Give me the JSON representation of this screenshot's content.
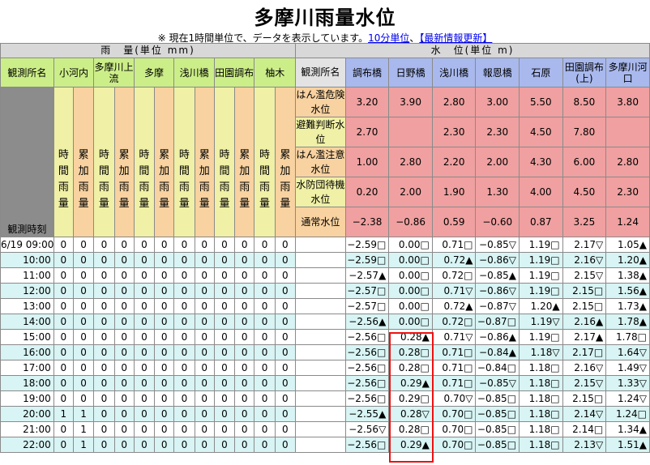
{
  "page": {
    "title": "多摩川雨量水位",
    "notice_prefix": "※ 現在1時間単位で、データを表示しています。",
    "link_10min": "10分単位",
    "link_refresh": "【最新情報更新】"
  },
  "rain_section": {
    "header": "雨　量(単位 mm)",
    "station_label": "観測所名",
    "stations": [
      "小河内",
      "多摩川上流",
      "多摩",
      "浅川橋",
      "田園調布",
      "柚木"
    ],
    "col_hourly": "時間雨量",
    "col_cumulative": "累加雨量",
    "time_label": "観測時刻"
  },
  "level_section": {
    "header": "水　位(単位 m)",
    "station_label": "観測所名",
    "stations": [
      "調布橋",
      "日野橋",
      "浅川橋",
      "報恩橋",
      "石原",
      "田園調布(上)",
      "多摩川河口"
    ],
    "levels": [
      {
        "name": "はん濫危険水位",
        "values": [
          "3.20",
          "3.90",
          "2.80",
          "3.00",
          "5.50",
          "8.50",
          "3.80"
        ]
      },
      {
        "name": "避難判断水位",
        "values": [
          "2.70",
          "",
          "2.30",
          "2.30",
          "4.50",
          "7.80",
          ""
        ]
      },
      {
        "name": "はん濫注意水位",
        "values": [
          "1.00",
          "2.80",
          "2.20",
          "2.00",
          "4.30",
          "6.00",
          "2.80"
        ]
      },
      {
        "name": "水防団待機水位",
        "values": [
          "0.20",
          "2.00",
          "1.90",
          "1.30",
          "4.00",
          "4.50",
          "2.30"
        ]
      },
      {
        "name": "通常水位",
        "values": [
          "−2.38",
          "−0.86",
          "0.59",
          "−0.60",
          "0.87",
          "3.25",
          "1.24"
        ]
      }
    ]
  },
  "data_rows": [
    {
      "time": "6/19 09:00",
      "rain": [
        "0",
        "0",
        "0",
        "0",
        "0",
        "0",
        "0",
        "0",
        "0",
        "0",
        "0",
        "0"
      ],
      "water": [
        "−2.59□",
        "0.00□",
        "0.71□",
        "−0.85▽",
        "1.19□",
        "2.17▽",
        "1.05▲"
      ]
    },
    {
      "time": "10:00",
      "rain": [
        "0",
        "0",
        "0",
        "0",
        "0",
        "0",
        "0",
        "0",
        "0",
        "0",
        "0",
        "0"
      ],
      "water": [
        "−2.59□",
        "0.00□",
        "0.72▲",
        "−0.86▽",
        "1.19□",
        "2.16▽",
        "1.20▲"
      ]
    },
    {
      "time": "11:00",
      "rain": [
        "0",
        "0",
        "0",
        "0",
        "0",
        "0",
        "0",
        "0",
        "0",
        "0",
        "0",
        "0"
      ],
      "water": [
        "−2.57▲",
        "0.00□",
        "0.72□",
        "−0.85▲",
        "1.19□",
        "2.15▽",
        "1.38▲"
      ]
    },
    {
      "time": "12:00",
      "rain": [
        "0",
        "0",
        "0",
        "0",
        "0",
        "0",
        "0",
        "0",
        "0",
        "0",
        "0",
        "0"
      ],
      "water": [
        "−2.57□",
        "0.00□",
        "0.71▽",
        "−0.86▽",
        "1.19□",
        "2.15□",
        "1.56▲"
      ]
    },
    {
      "time": "13:00",
      "rain": [
        "0",
        "0",
        "0",
        "0",
        "0",
        "0",
        "0",
        "0",
        "0",
        "0",
        "0",
        "0"
      ],
      "water": [
        "−2.57□",
        "0.00□",
        "0.72▲",
        "−0.87▽",
        "1.20▲",
        "2.15□",
        "1.73▲"
      ]
    },
    {
      "time": "14:00",
      "rain": [
        "0",
        "0",
        "0",
        "0",
        "0",
        "0",
        "0",
        "0",
        "0",
        "0",
        "0",
        "0"
      ],
      "water": [
        "−2.56▲",
        "0.00□",
        "0.72□",
        "−0.87□",
        "1.19▽",
        "2.16▲",
        "1.78▲"
      ]
    },
    {
      "time": "15:00",
      "rain": [
        "0",
        "0",
        "0",
        "0",
        "0",
        "0",
        "0",
        "0",
        "0",
        "0",
        "0",
        "0"
      ],
      "water": [
        "−2.56□",
        "0.28▲",
        "0.71▽",
        "−0.86▲",
        "1.19□",
        "2.17▲",
        "1.78□"
      ]
    },
    {
      "time": "16:00",
      "rain": [
        "0",
        "0",
        "0",
        "0",
        "0",
        "0",
        "0",
        "0",
        "0",
        "0",
        "0",
        "0"
      ],
      "water": [
        "−2.56□",
        "0.28□",
        "0.71□",
        "−0.84▲",
        "1.18▽",
        "2.17□",
        "1.64▽"
      ]
    },
    {
      "time": "17:00",
      "rain": [
        "0",
        "0",
        "0",
        "0",
        "0",
        "0",
        "0",
        "0",
        "0",
        "0",
        "0",
        "0"
      ],
      "water": [
        "−2.56□",
        "0.28□",
        "0.71□",
        "−0.84□",
        "1.18□",
        "2.16▽",
        "1.49▽"
      ]
    },
    {
      "time": "18:00",
      "rain": [
        "0",
        "0",
        "0",
        "0",
        "0",
        "0",
        "0",
        "0",
        "0",
        "0",
        "0",
        "0"
      ],
      "water": [
        "−2.56□",
        "0.29▲",
        "0.71□",
        "−0.85▽",
        "1.18□",
        "2.15▽",
        "1.33▽"
      ]
    },
    {
      "time": "19:00",
      "rain": [
        "0",
        "0",
        "0",
        "0",
        "0",
        "0",
        "0",
        "0",
        "0",
        "0",
        "0",
        "0"
      ],
      "water": [
        "−2.56□",
        "0.29□",
        "0.70▽",
        "−0.85□",
        "1.18□",
        "2.15□",
        "1.24▽"
      ]
    },
    {
      "time": "20:00",
      "rain": [
        "1",
        "1",
        "0",
        "0",
        "0",
        "0",
        "0",
        "0",
        "0",
        "0",
        "0",
        "0"
      ],
      "water": [
        "−2.55▲",
        "0.28▽",
        "0.70□",
        "−0.85□",
        "1.18□",
        "2.14▽",
        "1.24□"
      ]
    },
    {
      "time": "21:00",
      "rain": [
        "0",
        "1",
        "0",
        "0",
        "0",
        "0",
        "0",
        "0",
        "0",
        "0",
        "0",
        "0"
      ],
      "water": [
        "−2.56▽",
        "0.28□",
        "0.70□",
        "−0.85□",
        "1.18□",
        "2.14□",
        "1.34▲"
      ]
    },
    {
      "time": "22:00",
      "rain": [
        "0",
        "1",
        "0",
        "0",
        "0",
        "0",
        "0",
        "0",
        "0",
        "0",
        "0",
        "0"
      ],
      "water": [
        "−2.56□",
        "0.29▲",
        "0.70□",
        "−0.85□",
        "1.18□",
        "2.13▽",
        "1.51▲"
      ]
    }
  ],
  "colors": {
    "rain_header": "#ccee88",
    "level_header": "#a9b9ee",
    "hourly_column": "#f0f0a6",
    "cumulative_column": "#f8d2a0",
    "threshold_cell": "#f0a0a0",
    "alt_row": "#d8f4f4",
    "highlight_box": "#ee1111"
  }
}
